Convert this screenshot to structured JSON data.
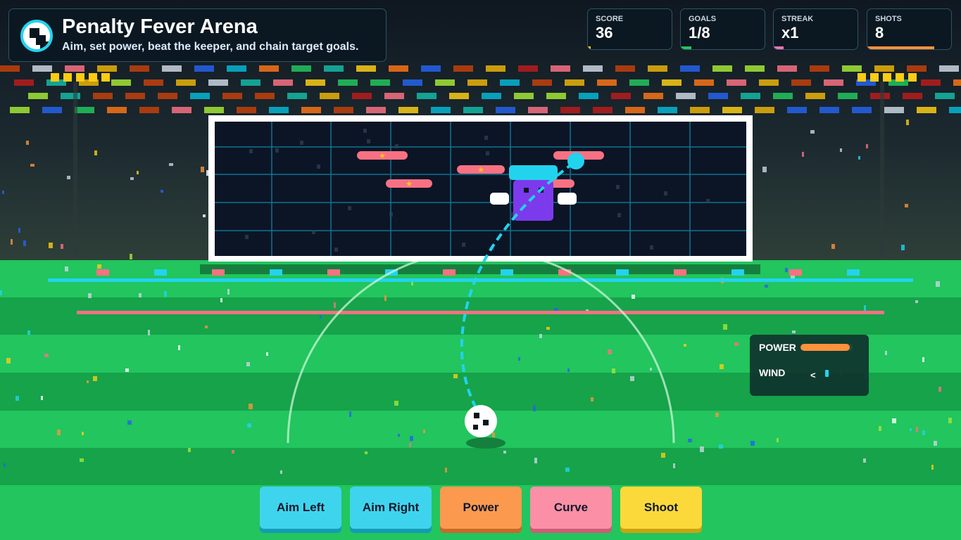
{
  "header": {
    "title": "Penalty Fever Arena",
    "subtitle": "Aim, set power, beat the keeper, and chain target goals.",
    "logo_icon": "soccer-ball-icon"
  },
  "stats": [
    {
      "label": "SCORE",
      "value": "36",
      "accent": "#facc15",
      "progress": 0.03
    },
    {
      "label": "GOALS",
      "value": "1/8",
      "accent": "#22c55e",
      "progress": 0.125
    },
    {
      "label": "STREAK",
      "value": "x1",
      "accent": "#f472b6",
      "progress": 0.12
    },
    {
      "label": "SHOTS",
      "value": "8",
      "accent": "#fb923c",
      "progress": 0.8
    }
  ],
  "hud": {
    "power_label": "POWER",
    "power_level": 0.95,
    "wind_label": "WIND",
    "wind_direction": "<"
  },
  "controls": [
    {
      "label": "Aim Left",
      "color": "#3fd4ee",
      "shade": "#159bb5"
    },
    {
      "label": "Aim Right",
      "color": "#3fd4ee",
      "shade": "#159bb5"
    },
    {
      "label": "Power",
      "color": "#fb9a4e",
      "shade": "#c7692a"
    },
    {
      "label": "Curve",
      "color": "#fb8fa6",
      "shade": "#cc5d76"
    },
    {
      "label": "Shoot",
      "color": "#fcd93a",
      "shade": "#c9a40f"
    }
  ],
  "game": {
    "targets": [
      {
        "label": "★",
        "star": true
      },
      {
        "label": "★",
        "star": true
      },
      {
        "label": "★",
        "star": true
      },
      {
        "label": "",
        "star": false
      },
      {
        "label": "",
        "star": false
      }
    ],
    "colors": {
      "pitch_light": "#22c55e",
      "pitch_dark": "#16a34a",
      "goal_net": "#0b1526",
      "net_lines": "#0e7490",
      "keeper": "#7c3aed",
      "keeper_cap": "#22d3ee",
      "target": "#f87183",
      "trajectory": "#22d3ee",
      "star": "#facc15"
    }
  }
}
